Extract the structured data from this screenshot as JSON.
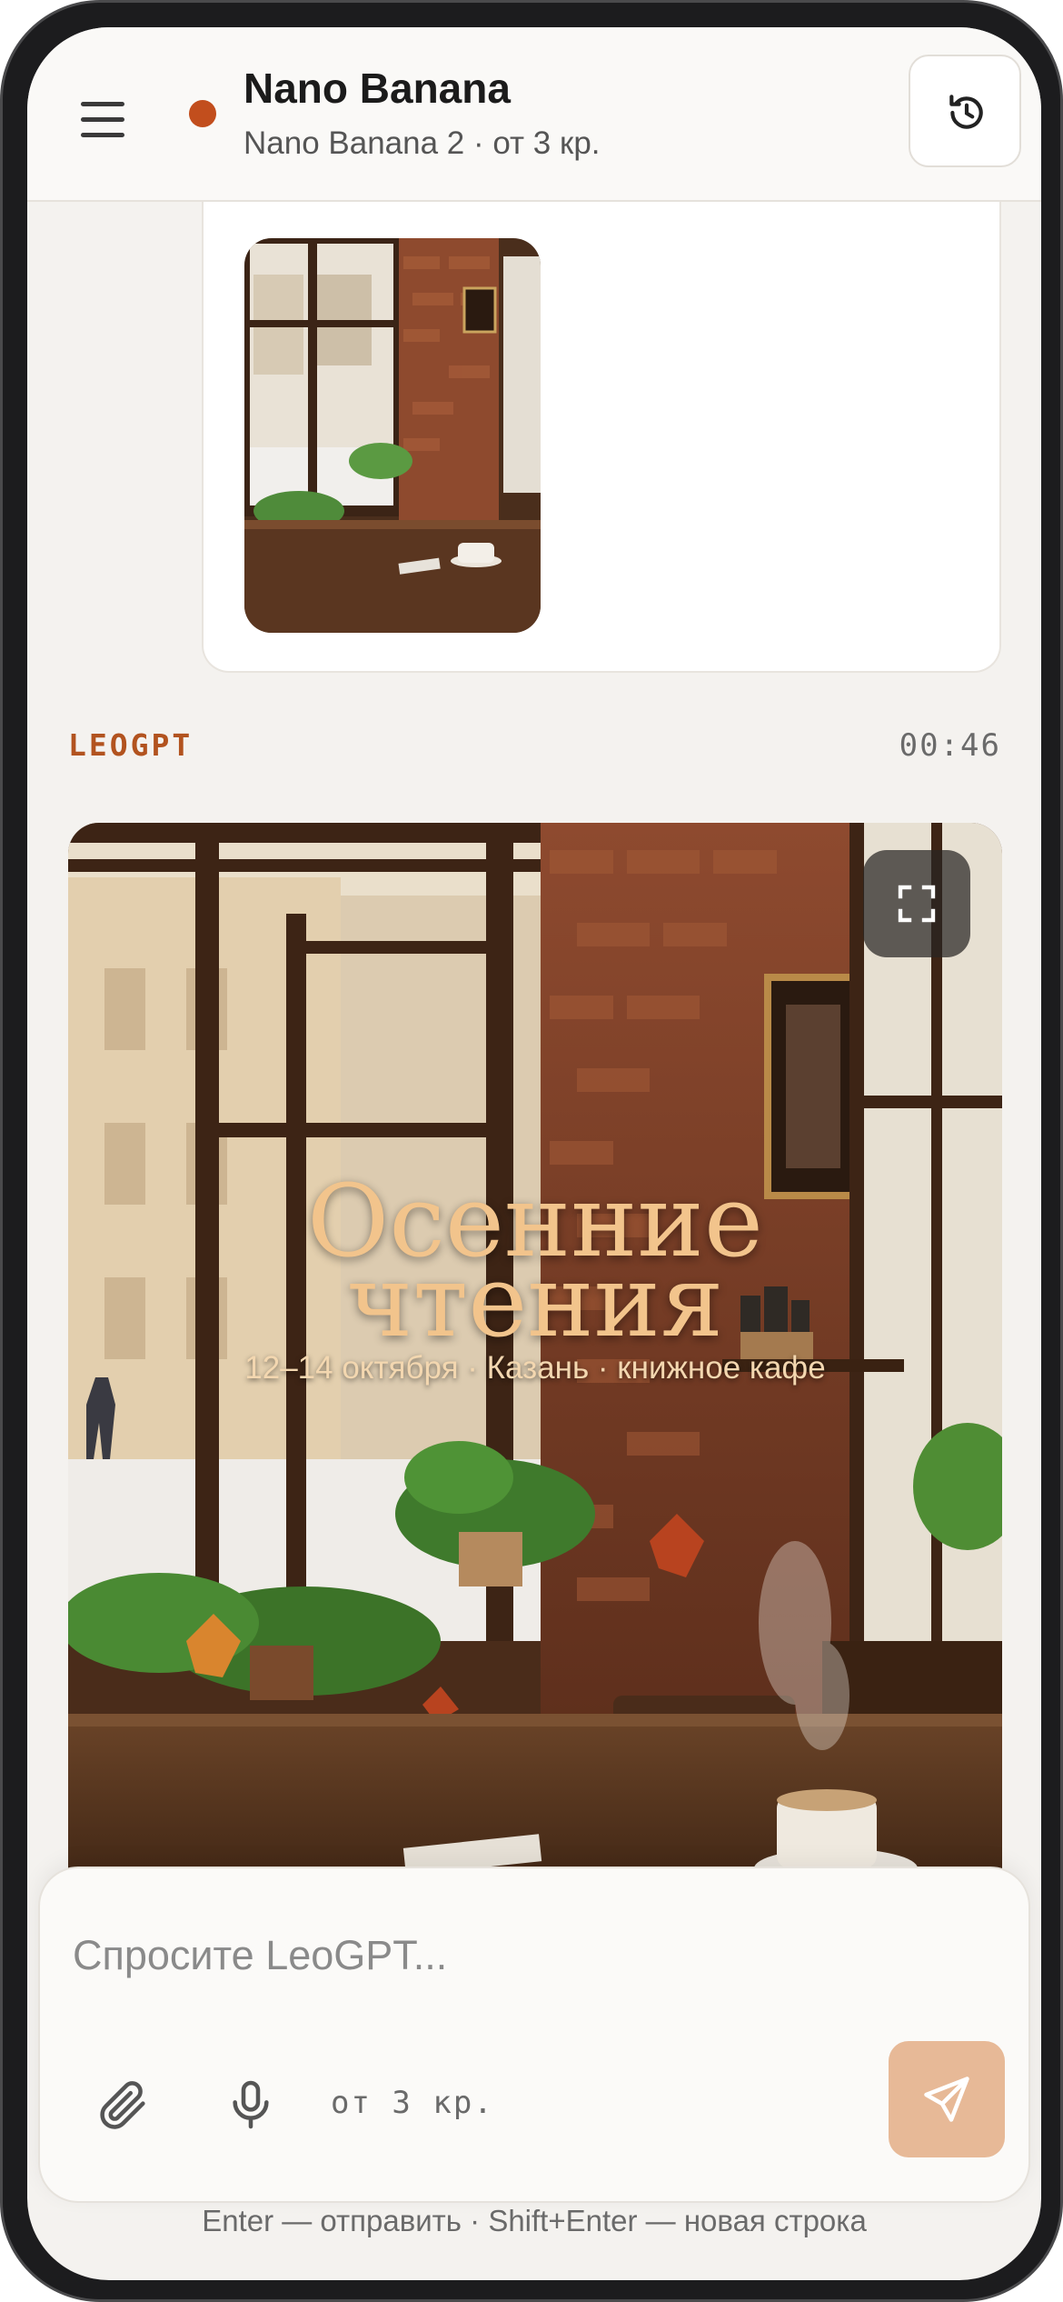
{
  "header": {
    "title": "Nano Banana",
    "subtitle": "Nano Banana 2 · от 3 кр.",
    "status_color": "#c24e1d",
    "menu_icon": "hamburger-menu-icon",
    "history_icon": "history-clock-icon"
  },
  "user_message": {
    "attachment": "photo of a café interior by a window"
  },
  "assistant_message": {
    "author": "LEOGPT",
    "time": "00:46",
    "image": {
      "title_line1": "Осенние",
      "title_line2": "чтения",
      "subtitle": "12–14 октября · Казань · книжное кафе",
      "expand_icon": "expand-fullscreen-icon"
    }
  },
  "composer": {
    "placeholder": "Спросите LeoGPT...",
    "value": "",
    "cost": "от 3 кр.",
    "attach_icon": "paperclip-icon",
    "mic_icon": "microphone-icon",
    "send_icon": "send-icon",
    "send_color": "#e7b997"
  },
  "footer": {
    "hint": "Enter — отправить · Shift+Enter — новая строка"
  },
  "colors": {
    "accent": "#b2531f",
    "background": "#f4f2ef"
  }
}
